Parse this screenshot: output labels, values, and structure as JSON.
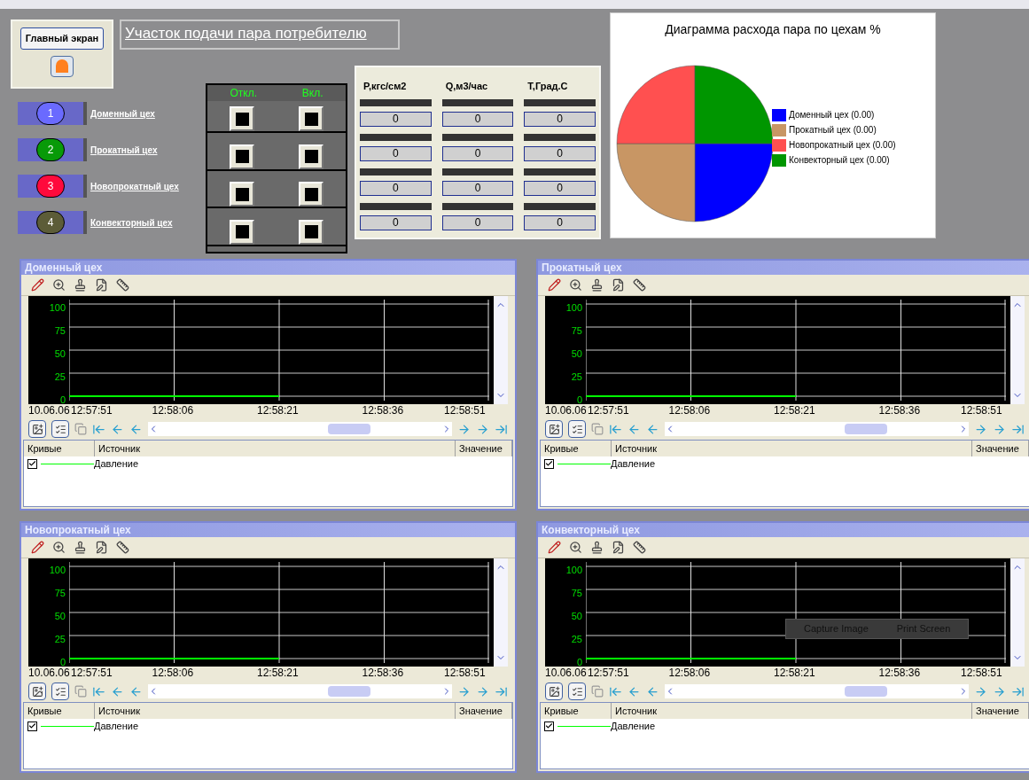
{
  "main_button": {
    "label": "Главный экран"
  },
  "title": "Участок подачи пара потребителю",
  "workshops": [
    {
      "number": "1",
      "label": "Доменный цех",
      "color": "#6a6aff"
    },
    {
      "number": "2",
      "label": "Прокатный цех",
      "color": "#089a08"
    },
    {
      "number": "3",
      "label": "Новопрокатный цех",
      "color": "#ff0a3c"
    },
    {
      "number": "4",
      "label": "Конвекторный цех",
      "color": "#5c5c38"
    }
  ],
  "switch_headers": [
    "Откл.",
    "Вкл."
  ],
  "readings": {
    "columns": [
      "P,кгс/см2",
      "Q,м3/час",
      "T,Град.С"
    ],
    "rows": [
      [
        "0",
        "0",
        "0"
      ],
      [
        "0",
        "0",
        "0"
      ],
      [
        "0",
        "0",
        "0"
      ],
      [
        "0",
        "0",
        "0"
      ]
    ]
  },
  "pie": {
    "title": "Диаграмма расхода пара по цехам %",
    "legend": [
      {
        "label": "Доменный цех (0.00)",
        "color": "#0000ff"
      },
      {
        "label": "Прокатный цех (0.00)",
        "color": "#c89664"
      },
      {
        "label": "Новопрокатный цех (0.00)",
        "color": "#ff5050"
      },
      {
        "label": "Конвекторный цех (0.00)",
        "color": "#009600"
      }
    ]
  },
  "trends": [
    {
      "title": "Доменный цех",
      "date": "10.06.06",
      "columns": [
        "Кривые",
        "Источник",
        "Значение"
      ],
      "curves": [
        {
          "checked": true
        }
      ],
      "chart_data": {
        "type": "line",
        "grid": true,
        "ylim": [
          0,
          100
        ],
        "yticks": [
          0,
          25,
          50,
          75,
          100
        ],
        "categories": [
          "12:57:51",
          "12:58:06",
          "12:58:21",
          "12:58:36",
          "12:58:51"
        ],
        "series": [
          {
            "name": "Давление",
            "color": "#00ff00",
            "values": [
              0,
              0,
              0,
              null,
              null
            ]
          }
        ]
      }
    },
    {
      "title": "Прокатный цех",
      "date": "10.06.06",
      "columns": [
        "Кривые",
        "Источник",
        "Значение"
      ],
      "curves": [
        {
          "checked": true
        }
      ],
      "chart_data": {
        "type": "line",
        "grid": true,
        "ylim": [
          0,
          100
        ],
        "yticks": [
          0,
          25,
          50,
          75,
          100
        ],
        "categories": [
          "12:57:51",
          "12:58:06",
          "12:58:21",
          "12:58:36",
          "12:58:51"
        ],
        "series": [
          {
            "name": "Давление",
            "color": "#00ff00",
            "values": [
              0,
              0,
              0,
              null,
              null
            ]
          }
        ]
      }
    },
    {
      "title": "Новопрокатный цех",
      "date": "10.06.06",
      "columns": [
        "Кривые",
        "Источник",
        "Значение"
      ],
      "curves": [
        {
          "checked": true
        }
      ],
      "chart_data": {
        "type": "line",
        "grid": true,
        "ylim": [
          0,
          100
        ],
        "yticks": [
          0,
          25,
          50,
          75,
          100
        ],
        "categories": [
          "12:57:51",
          "12:58:06",
          "12:58:21",
          "12:58:36",
          "12:58:51"
        ],
        "series": [
          {
            "name": "Давление",
            "color": "#00ff00",
            "values": [
              0,
              0,
              0,
              null,
              null
            ]
          }
        ]
      }
    },
    {
      "title": "Конвекторный цех",
      "date": "10.06.06",
      "columns": [
        "Кривые",
        "Источник",
        "Значение"
      ],
      "curves": [
        {
          "checked": true
        }
      ],
      "context_menu": [
        "Capture Image",
        "Print Screen"
      ],
      "chart_data": {
        "type": "line",
        "grid": true,
        "ylim": [
          0,
          100
        ],
        "yticks": [
          0,
          25,
          50,
          75,
          100
        ],
        "categories": [
          "12:57:51",
          "12:58:06",
          "12:58:21",
          "12:58:36",
          "12:58:51"
        ],
        "series": [
          {
            "name": "Давление",
            "color": "#00ff00",
            "values": [
              0,
              0,
              0,
              null,
              null
            ]
          }
        ]
      }
    }
  ]
}
